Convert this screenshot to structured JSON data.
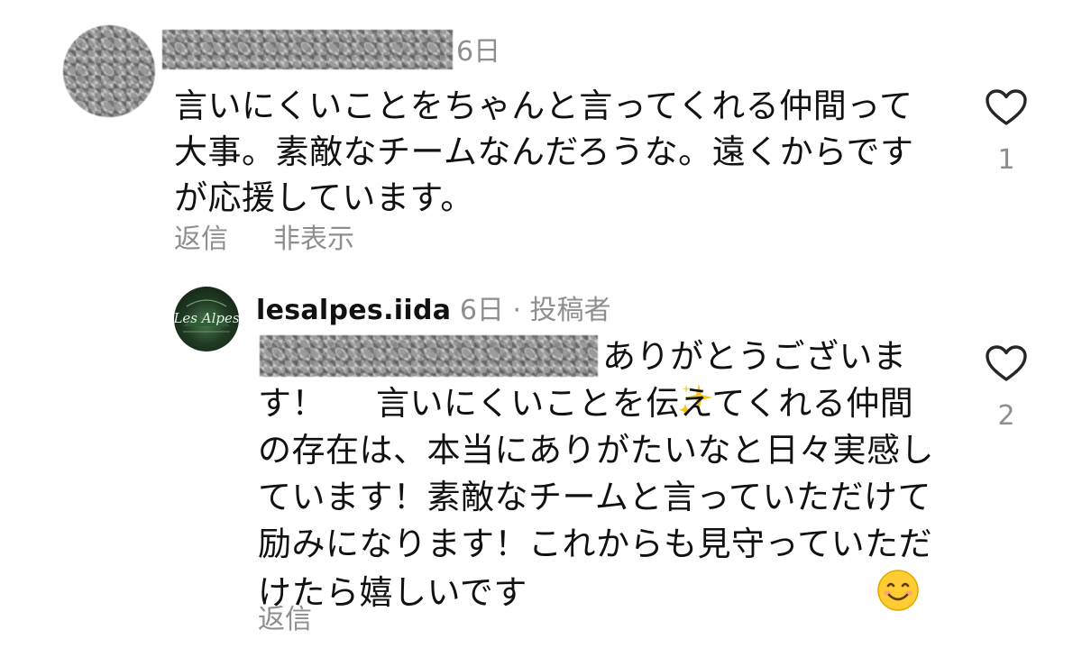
{
  "comment": {
    "time": "6日",
    "text": "言いにくいことをちゃんと言ってくれる仲間って大事。素敵なチームなんだろうな。遠くからですが応援しています。",
    "actions": {
      "reply_label": "返信",
      "hide_label": "非表示"
    },
    "like_count": "1",
    "like_icon": "heart-outline-icon"
  },
  "reply": {
    "username": "lesalpes.iida",
    "meta": "6日 · 投稿者",
    "avatar_logo_text": "Les Alpes",
    "text_line_first": "ありがとうございま",
    "text_part_1": "す！",
    "sparkle_emoji": "sparkles-emoji",
    "text_part_2": "言いにくいことを伝えてくれる仲間の存在は、本当にありがたいなと日々実感しています！素敵なチームと言っていただけて励みになります！これからも見守っていただけたら嬉しいです",
    "smile_emoji": "smiling-face-emoji",
    "actions": {
      "reply_label": "返信"
    },
    "like_count": "2",
    "like_icon": "heart-outline-icon"
  }
}
